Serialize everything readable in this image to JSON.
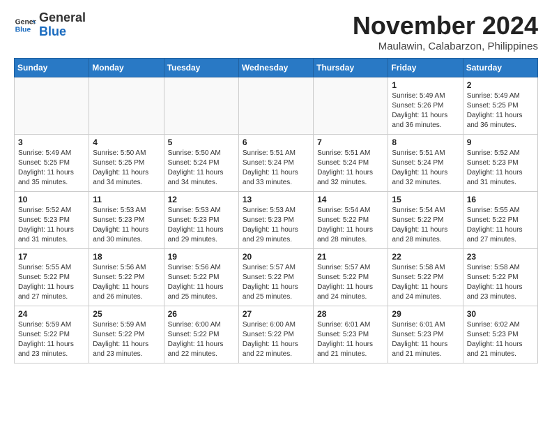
{
  "header": {
    "logo_general": "General",
    "logo_blue": "Blue",
    "title": "November 2024",
    "location": "Maulawin, Calabarzon, Philippines"
  },
  "weekdays": [
    "Sunday",
    "Monday",
    "Tuesday",
    "Wednesday",
    "Thursday",
    "Friday",
    "Saturday"
  ],
  "weeks": [
    [
      {
        "day": "",
        "info": ""
      },
      {
        "day": "",
        "info": ""
      },
      {
        "day": "",
        "info": ""
      },
      {
        "day": "",
        "info": ""
      },
      {
        "day": "",
        "info": ""
      },
      {
        "day": "1",
        "info": "Sunrise: 5:49 AM\nSunset: 5:26 PM\nDaylight: 11 hours\nand 36 minutes."
      },
      {
        "day": "2",
        "info": "Sunrise: 5:49 AM\nSunset: 5:25 PM\nDaylight: 11 hours\nand 36 minutes."
      }
    ],
    [
      {
        "day": "3",
        "info": "Sunrise: 5:49 AM\nSunset: 5:25 PM\nDaylight: 11 hours\nand 35 minutes."
      },
      {
        "day": "4",
        "info": "Sunrise: 5:50 AM\nSunset: 5:25 PM\nDaylight: 11 hours\nand 34 minutes."
      },
      {
        "day": "5",
        "info": "Sunrise: 5:50 AM\nSunset: 5:24 PM\nDaylight: 11 hours\nand 34 minutes."
      },
      {
        "day": "6",
        "info": "Sunrise: 5:51 AM\nSunset: 5:24 PM\nDaylight: 11 hours\nand 33 minutes."
      },
      {
        "day": "7",
        "info": "Sunrise: 5:51 AM\nSunset: 5:24 PM\nDaylight: 11 hours\nand 32 minutes."
      },
      {
        "day": "8",
        "info": "Sunrise: 5:51 AM\nSunset: 5:24 PM\nDaylight: 11 hours\nand 32 minutes."
      },
      {
        "day": "9",
        "info": "Sunrise: 5:52 AM\nSunset: 5:23 PM\nDaylight: 11 hours\nand 31 minutes."
      }
    ],
    [
      {
        "day": "10",
        "info": "Sunrise: 5:52 AM\nSunset: 5:23 PM\nDaylight: 11 hours\nand 31 minutes."
      },
      {
        "day": "11",
        "info": "Sunrise: 5:53 AM\nSunset: 5:23 PM\nDaylight: 11 hours\nand 30 minutes."
      },
      {
        "day": "12",
        "info": "Sunrise: 5:53 AM\nSunset: 5:23 PM\nDaylight: 11 hours\nand 29 minutes."
      },
      {
        "day": "13",
        "info": "Sunrise: 5:53 AM\nSunset: 5:23 PM\nDaylight: 11 hours\nand 29 minutes."
      },
      {
        "day": "14",
        "info": "Sunrise: 5:54 AM\nSunset: 5:22 PM\nDaylight: 11 hours\nand 28 minutes."
      },
      {
        "day": "15",
        "info": "Sunrise: 5:54 AM\nSunset: 5:22 PM\nDaylight: 11 hours\nand 28 minutes."
      },
      {
        "day": "16",
        "info": "Sunrise: 5:55 AM\nSunset: 5:22 PM\nDaylight: 11 hours\nand 27 minutes."
      }
    ],
    [
      {
        "day": "17",
        "info": "Sunrise: 5:55 AM\nSunset: 5:22 PM\nDaylight: 11 hours\nand 27 minutes."
      },
      {
        "day": "18",
        "info": "Sunrise: 5:56 AM\nSunset: 5:22 PM\nDaylight: 11 hours\nand 26 minutes."
      },
      {
        "day": "19",
        "info": "Sunrise: 5:56 AM\nSunset: 5:22 PM\nDaylight: 11 hours\nand 25 minutes."
      },
      {
        "day": "20",
        "info": "Sunrise: 5:57 AM\nSunset: 5:22 PM\nDaylight: 11 hours\nand 25 minutes."
      },
      {
        "day": "21",
        "info": "Sunrise: 5:57 AM\nSunset: 5:22 PM\nDaylight: 11 hours\nand 24 minutes."
      },
      {
        "day": "22",
        "info": "Sunrise: 5:58 AM\nSunset: 5:22 PM\nDaylight: 11 hours\nand 24 minutes."
      },
      {
        "day": "23",
        "info": "Sunrise: 5:58 AM\nSunset: 5:22 PM\nDaylight: 11 hours\nand 23 minutes."
      }
    ],
    [
      {
        "day": "24",
        "info": "Sunrise: 5:59 AM\nSunset: 5:22 PM\nDaylight: 11 hours\nand 23 minutes."
      },
      {
        "day": "25",
        "info": "Sunrise: 5:59 AM\nSunset: 5:22 PM\nDaylight: 11 hours\nand 23 minutes."
      },
      {
        "day": "26",
        "info": "Sunrise: 6:00 AM\nSunset: 5:22 PM\nDaylight: 11 hours\nand 22 minutes."
      },
      {
        "day": "27",
        "info": "Sunrise: 6:00 AM\nSunset: 5:22 PM\nDaylight: 11 hours\nand 22 minutes."
      },
      {
        "day": "28",
        "info": "Sunrise: 6:01 AM\nSunset: 5:23 PM\nDaylight: 11 hours\nand 21 minutes."
      },
      {
        "day": "29",
        "info": "Sunrise: 6:01 AM\nSunset: 5:23 PM\nDaylight: 11 hours\nand 21 minutes."
      },
      {
        "day": "30",
        "info": "Sunrise: 6:02 AM\nSunset: 5:23 PM\nDaylight: 11 hours\nand 21 minutes."
      }
    ]
  ]
}
